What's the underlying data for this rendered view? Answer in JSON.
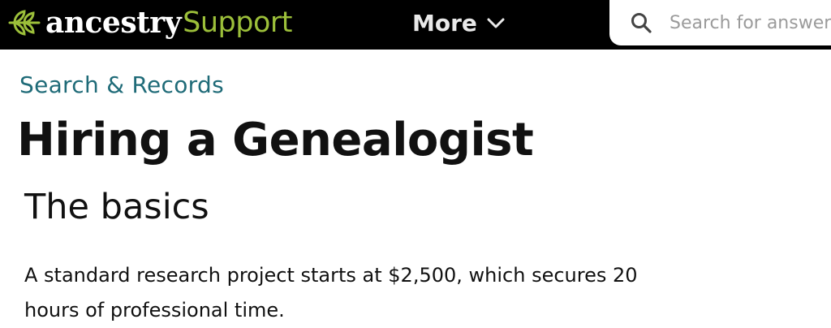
{
  "header": {
    "brand": "ancestry",
    "brand_sub": "Support",
    "more_label": "More",
    "search_placeholder": "Search for answers"
  },
  "icons": {
    "logo": "leaf-icon",
    "more": "chevron-down-icon",
    "search": "search-icon"
  },
  "colors": {
    "header_bg": "#000000",
    "brand_green": "#9cbf3a",
    "breadcrumb": "#1f6b78"
  },
  "article": {
    "breadcrumb": "Search & Records",
    "title": "Hiring a Genealogist",
    "subheading": "The basics",
    "paragraph": "A standard research project starts at $2,500, which secures 20 hours of professional time."
  }
}
